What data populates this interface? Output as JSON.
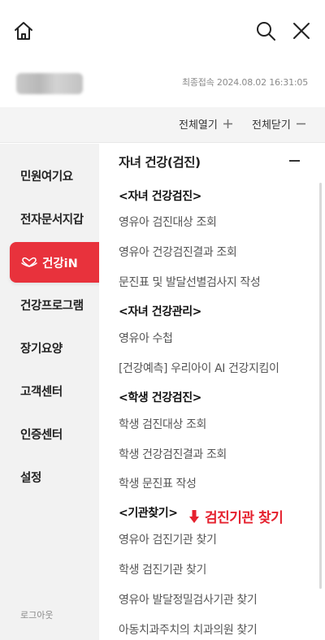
{
  "header": {
    "home_icon": "home-icon",
    "search_icon": "search-icon",
    "close_icon": "close-icon"
  },
  "user": {
    "last_login": "최종접속 2024.08.02 16:31:05"
  },
  "toolbar": {
    "expand_all": "전체열기",
    "collapse_all": "전체닫기"
  },
  "sidebar": {
    "items": [
      {
        "label": "민원여기요"
      },
      {
        "label": "전자문서지갑"
      },
      {
        "label": "건강iN",
        "active": true,
        "icon": "heart-hands-icon"
      },
      {
        "label": "건강프로그램"
      },
      {
        "label": "장기요양"
      },
      {
        "label": "고객센터"
      },
      {
        "label": "인증센터"
      },
      {
        "label": "설정"
      }
    ],
    "logout": "로그아웃",
    "active_color": "#e8323c"
  },
  "content": {
    "section_title": "자녀 건강(검진)",
    "groups": [
      {
        "title": "<자녀 건강검진>",
        "links": [
          "영유아 검진대상 조회",
          "영유아 건강검진결과 조회",
          "문진표 및 발달선별검사지 작성"
        ]
      },
      {
        "title": "<자녀 건강관리>",
        "links": [
          "영유아 수첩",
          "[건강예측] 우리아이 AI 건강지킴이"
        ]
      },
      {
        "title": "<학생 건강검진>",
        "links": [
          "학생 검진대상 조회",
          "학생 건강검진결과 조회",
          "학생 문진표 작성"
        ]
      },
      {
        "title": "<기관찾기>",
        "links": [
          "영유아 검진기관 찾기",
          "학생 검진기관 찾기",
          "영유아 발달정밀검사기관 찾기",
          "아동치과주치의 치과의원 찾기"
        ]
      }
    ],
    "annotation": "검진기관 찾기",
    "annotation_color": "#e5212e"
  }
}
